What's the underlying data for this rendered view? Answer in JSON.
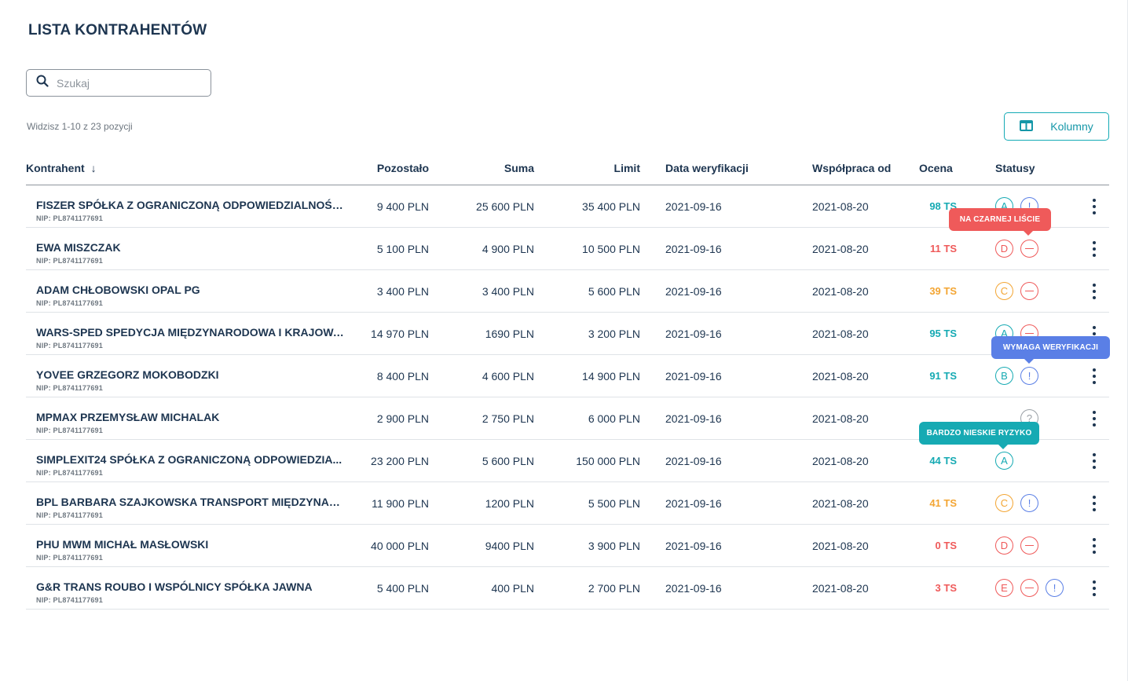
{
  "page": {
    "title": "LISTA KONTRAHENTÓW"
  },
  "search": {
    "placeholder": "Szukaj",
    "icon": "search-icon"
  },
  "count_text": "Widzisz 1-10 z 23 pozycji",
  "columns_button": {
    "label": "Kolumny",
    "icon": "columns-icon",
    "color": "#14aab5"
  },
  "colors": {
    "teal": "#16aab3",
    "red": "#ef5a5a",
    "orange": "#f3a533",
    "blue": "#5a7fe6",
    "gray": "#9aa0a6",
    "text": "#1d3550"
  },
  "table": {
    "headers": {
      "kontrahent": "Kontrahent",
      "sort_arrow": "↓",
      "pozostalo": "Pozostało",
      "suma": "Suma",
      "limit": "Limit",
      "data_weryfikacji": "Data weryfikacji",
      "wspolpraca_od": "Współpraca od",
      "ocena": "Ocena",
      "statusy": "Statusy"
    },
    "rows": [
      {
        "name": "FISZER SPÓŁKA Z OGRANICZONĄ ODPOWIEDZIALNOŚCIĄ",
        "nip": "NIP: PL8741177691",
        "pozostalo": "9 400 PLN",
        "suma": "25 600 PLN",
        "limit": "35 400 PLN",
        "data_weryfikacji": "2021-09-16",
        "wspolpraca_od": "2021-08-20",
        "ocena": "98 TS",
        "ocena_color": "teal",
        "statuses": [
          {
            "type": "grade",
            "label": "A",
            "color": "teal"
          },
          {
            "type": "alert",
            "label": "!",
            "color": "blue"
          }
        ]
      },
      {
        "name": "EWA MISZCZAK",
        "nip": "NIP: PL8741177691",
        "pozostalo": "5 100 PLN",
        "suma": "4 900 PLN",
        "limit": "10 500 PLN",
        "data_weryfikacji": "2021-09-16",
        "wspolpraca_od": "2021-08-20",
        "ocena": "11 TS",
        "ocena_color": "red",
        "statuses": [
          {
            "type": "grade",
            "label": "D",
            "color": "red"
          },
          {
            "type": "minus",
            "label": "",
            "color": "red"
          }
        ]
      },
      {
        "name": "ADAM CHŁOBOWSKI OPAL PG",
        "nip": "NIP: PL8741177691",
        "pozostalo": "3 400 PLN",
        "suma": "3 400 PLN",
        "limit": "5 600 PLN",
        "data_weryfikacji": "2021-09-16",
        "wspolpraca_od": "2021-08-20",
        "ocena": "39 TS",
        "ocena_color": "orange",
        "statuses": [
          {
            "type": "grade",
            "label": "C",
            "color": "orange"
          },
          {
            "type": "minus",
            "label": "",
            "color": "red"
          }
        ]
      },
      {
        "name": "WARS-SPED SPEDYCJA MIĘDZYNARODOWA I KRAJOWA...",
        "nip": "NIP: PL8741177691",
        "pozostalo": "14 970 PLN",
        "suma": "1690 PLN",
        "limit": "3 200 PLN",
        "data_weryfikacji": "2021-09-16",
        "wspolpraca_od": "2021-08-20",
        "ocena": "95 TS",
        "ocena_color": "teal",
        "statuses": [
          {
            "type": "grade",
            "label": "A",
            "color": "teal"
          },
          {
            "type": "minus",
            "label": "",
            "color": "red"
          }
        ]
      },
      {
        "name": "YOVEE GRZEGORZ MOKOBODZKI",
        "nip": "NIP: PL8741177691",
        "pozostalo": "8 400 PLN",
        "suma": "4 600 PLN",
        "limit": "14 900 PLN",
        "data_weryfikacji": "2021-09-16",
        "wspolpraca_od": "2021-08-20",
        "ocena": "91 TS",
        "ocena_color": "teal",
        "statuses": [
          {
            "type": "grade",
            "label": "B",
            "color": "teal"
          },
          {
            "type": "alert",
            "label": "!",
            "color": "blue"
          }
        ]
      },
      {
        "name": "MPMAX PRZEMYSŁAW MICHALAK",
        "nip": "NIP: PL8741177691",
        "pozostalo": "2 900 PLN",
        "suma": "2 750 PLN",
        "limit": "6 000 PLN",
        "data_weryfikacji": "2021-09-16",
        "wspolpraca_od": "2021-08-20",
        "ocena": "",
        "ocena_color": "gray",
        "statuses": [
          {
            "type": "unknown",
            "label": "?",
            "color": "gray",
            "slot": 2
          }
        ]
      },
      {
        "name": "SIMPLEXIT24 SPÓŁKA Z OGRANICZONĄ ODPOWIEDZIA...",
        "nip": "NIP: PL8741177691",
        "pozostalo": "23 200 PLN",
        "suma": "5 600 PLN",
        "limit": "150 000 PLN",
        "data_weryfikacji": "2021-09-16",
        "wspolpraca_od": "2021-08-20",
        "ocena": "44 TS",
        "ocena_color": "teal",
        "statuses": [
          {
            "type": "grade",
            "label": "A",
            "color": "teal"
          }
        ]
      },
      {
        "name": "BPL BARBARA SZAJKOWSKA TRANSPORT MIĘDZYNARO...",
        "nip": "NIP: PL8741177691",
        "pozostalo": "11 900 PLN",
        "suma": "1200 PLN",
        "limit": "5 500 PLN",
        "data_weryfikacji": "2021-09-16",
        "wspolpraca_od": "2021-08-20",
        "ocena": "41 TS",
        "ocena_color": "orange",
        "statuses": [
          {
            "type": "grade",
            "label": "C",
            "color": "orange"
          },
          {
            "type": "alert",
            "label": "!",
            "color": "blue"
          }
        ]
      },
      {
        "name": "PHU MWM MICHAŁ MASŁOWSKI",
        "nip": "NIP: PL8741177691",
        "pozostalo": "40  000 PLN",
        "suma": "9400 PLN",
        "limit": "3  900 PLN",
        "data_weryfikacji": "2021-09-16",
        "wspolpraca_od": "2021-08-20",
        "ocena": "0 TS",
        "ocena_color": "red",
        "statuses": [
          {
            "type": "grade",
            "label": "D",
            "color": "red"
          },
          {
            "type": "minus",
            "label": "",
            "color": "red"
          }
        ]
      },
      {
        "name": "G&R TRANS ROUBO I WSPÓLNICY SPÓŁKA JAWNA",
        "nip": "NIP: PL8741177691",
        "pozostalo": "5 400 PLN",
        "suma": "400 PLN",
        "limit": "2 700 PLN",
        "data_weryfikacji": "2021-09-16",
        "wspolpraca_od": "2021-08-20",
        "ocena": "3 TS",
        "ocena_color": "red",
        "statuses": [
          {
            "type": "grade",
            "label": "E",
            "color": "red"
          },
          {
            "type": "minus",
            "label": "",
            "color": "red"
          },
          {
            "type": "alert",
            "label": "!",
            "color": "blue"
          }
        ]
      }
    ],
    "row_menu_icon": "more-vertical-icon"
  },
  "tooltips": {
    "blacklist": "NA CZARNEJ LIŚCIE",
    "verification": "WYMAGA WERYFIKACJI",
    "low_risk": "BARDZO NIESKIE RYZYKO"
  }
}
